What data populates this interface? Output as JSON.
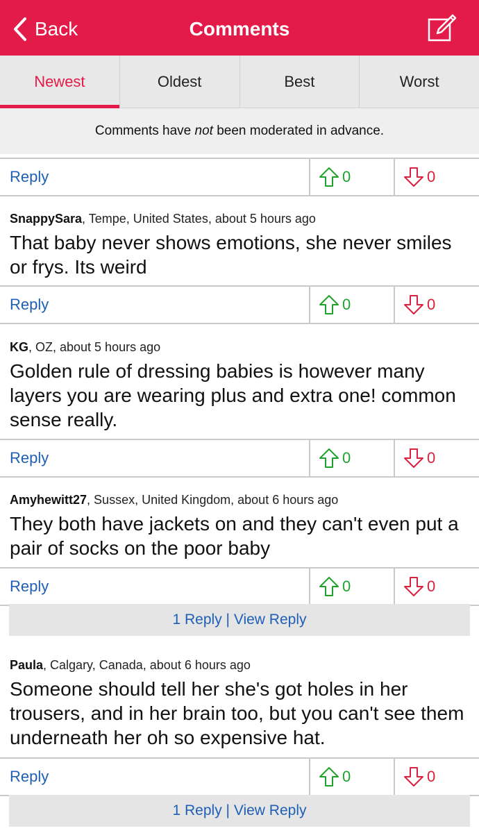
{
  "header": {
    "back_label": "Back",
    "title": "Comments",
    "accent": "#e31b48"
  },
  "tabs": [
    {
      "label": "Newest",
      "active": true
    },
    {
      "label": "Oldest"
    },
    {
      "label": "Best"
    },
    {
      "label": "Worst"
    }
  ],
  "notice": {
    "before": "Comments have ",
    "emphasis": "not",
    "after": " been moderated in advance."
  },
  "top_row": {
    "reply": "Reply",
    "up": "0",
    "down": "0"
  },
  "comments": [
    {
      "author": "SnappySara",
      "meta": ", Tempe, United States, about 5 hours ago",
      "text": "That baby never shows emotions, she never smiles or frys. Its weird",
      "reply": "Reply",
      "up": "0",
      "down": "0"
    },
    {
      "author": "KG",
      "meta": ", OZ, about 5 hours ago",
      "text": "Golden rule of dressing babies is however many layers you are wearing plus and extra one! common sense really.",
      "reply": "Reply",
      "up": "0",
      "down": "0"
    },
    {
      "author": "Amyhewitt27",
      "meta": ", Sussex, United Kingdom, about 6 hours ago",
      "text": "They both have jackets on and they can't even put a pair of socks on the poor baby",
      "reply": "Reply",
      "up": "0",
      "down": "0",
      "view_reply": "1 Reply | View Reply"
    },
    {
      "author": "Paula",
      "meta": ", Calgary, Canada, about 6 hours ago",
      "text": "Someone should tell her she's got holes in her trousers, and in her brain too, but you can't see them underneath her oh so expensive hat.",
      "reply": "Reply",
      "up": "0",
      "down": "0",
      "view_reply": "1 Reply | View Reply"
    }
  ]
}
